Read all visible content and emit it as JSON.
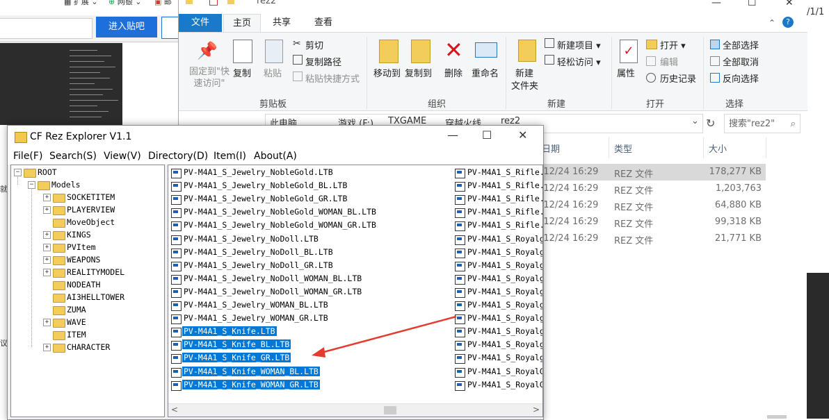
{
  "browser": {
    "bookmarks": [
      "扩展",
      "网银",
      "邮"
    ],
    "enter_button": "进入贴吧",
    "left_edge_texts": [
      "就",
      "议"
    ]
  },
  "explorer": {
    "window_title": "rez2",
    "right_fragment": "/1/1",
    "tabs": [
      "文件",
      "主页",
      "共享",
      "查看"
    ],
    "clipboard": {
      "pin": "固定到\"快速访问\"",
      "copy": "复制",
      "paste": "粘贴",
      "cut": "剪切",
      "copy_path": "复制路径",
      "paste_shortcut": "粘贴快捷方式",
      "group": "剪贴板"
    },
    "organize": {
      "move_to": "移动到",
      "copy_to": "复制到",
      "delete": "删除",
      "rename": "重命名",
      "group": "组织"
    },
    "new": {
      "new_folder_line1": "新建",
      "new_folder_line2": "文件夹",
      "new_item": "新建项目",
      "easy_access": "轻松访问",
      "group": "新建"
    },
    "open": {
      "properties": "属性",
      "open": "打开",
      "edit": "编辑",
      "history": "历史记录",
      "group": "打开"
    },
    "select": {
      "select_all": "全部选择",
      "select_none": "全部取消",
      "invert": "反向选择",
      "group": "选择"
    },
    "breadcrumb": [
      "此电脑",
      "游戏 (F:)",
      "TXGAME",
      "穿越火线",
      "rez2"
    ],
    "search_placeholder": "搜索\"rez2\"",
    "columns": {
      "date": "日期",
      "type": "类型",
      "size": "大小"
    },
    "files": [
      {
        "date": "/12/24 16:29",
        "type": "REZ 文件",
        "size": "178,277 KB"
      },
      {
        "date": "/12/24 16:29",
        "type": "REZ 文件",
        "size": "1,203,763"
      },
      {
        "date": "/12/24 16:29",
        "type": "REZ 文件",
        "size": "64,880 KB"
      },
      {
        "date": "/12/24 16:29",
        "type": "REZ 文件",
        "size": "99,318 KB"
      },
      {
        "date": "/12/24 16:29",
        "type": "REZ 文件",
        "size": "21,771 KB"
      }
    ]
  },
  "rez": {
    "title": "CF Rez Explorer V1.1",
    "menu": [
      "File(F)",
      "Search(S)",
      "View(V)",
      "Directory(D)",
      "Item(I)",
      "About(A)"
    ],
    "tree": {
      "root": "ROOT",
      "models": "Models",
      "children": [
        "SOCKETITEM",
        "PLAYERVIEW",
        "MoveObject",
        "KINGS",
        "PVItem",
        "WEAPONS",
        "REALITYMODEL",
        "NODEATH",
        "AI3HELLTOWER",
        "ZUMA",
        "WAVE",
        "ITEM",
        "CHARACTER"
      ]
    },
    "col1": [
      "PV-M4A1_S_Jewelry_NobleGold.LTB",
      "PV-M4A1_S_Jewelry_NobleGold_BL.LTB",
      "PV-M4A1_S_Jewelry_NobleGold_GR.LTB",
      "PV-M4A1_S_Jewelry_NobleGold_WOMAN_BL.LTB",
      "PV-M4A1_S_Jewelry_NobleGold_WOMAN_GR.LTB",
      "PV-M4A1_S_Jewelry_NoDoll.LTB",
      "PV-M4A1_S_Jewelry_NoDoll_BL.LTB",
      "PV-M4A1_S_Jewelry_NoDoll_GR.LTB",
      "PV-M4A1_S_Jewelry_NoDoll_WOMAN_BL.LTB",
      "PV-M4A1_S_Jewelry_NoDoll_WOMAN_GR.LTB",
      "PV-M4A1_S_Jewelry_WOMAN_BL.LTB",
      "PV-M4A1_S_Jewelry_WOMAN_GR.LTB",
      "PV-M4A1_S_Knife.LTB",
      "PV-M4A1_S_Knife_BL.LTB",
      "PV-M4A1_S_Knife_GR.LTB",
      "PV-M4A1_S_Knife_WOMAN_BL.LTB",
      "PV-M4A1_S_Knife_WOMAN_GR.LTB"
    ],
    "col2": [
      "PV-M4A1_S_Rifle.",
      "PV-M4A1_S_Rifle.",
      "PV-M4A1_S_Rifle.",
      "PV-M4A1_S_Rifle.",
      "PV-M4A1_S_Rifle.",
      "PV-M4A1_S_Royalg",
      "PV-M4A1_S_Royalg",
      "PV-M4A1_S_Royalg",
      "PV-M4A1_S_Royalg",
      "PV-M4A1_S_Royalg",
      "PV-M4A1_S_Royalg",
      "PV-M4A1_S_Royalg",
      "PV-M4A1_S_Royalg",
      "PV-M4A1_S_Royalg",
      "PV-M4A1_S_Royalg",
      "PV-M4A1_S_RoyalG",
      "PV-M4A1_S_RoyalG"
    ],
    "selected_col1": [
      12,
      13,
      14,
      15,
      16
    ]
  }
}
